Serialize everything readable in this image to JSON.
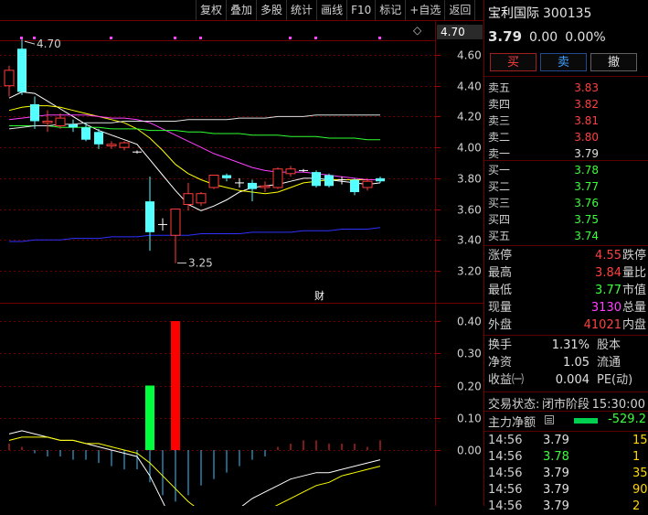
{
  "toolbar": {
    "items": [
      "复权",
      "叠加",
      "多股",
      "统计",
      "画线",
      "F10",
      "标记",
      "+自选",
      "返回"
    ]
  },
  "main_chart": {
    "price_ticks": [
      "4.60",
      "4.40",
      "4.20",
      "4.00",
      "3.80",
      "3.60",
      "3.40",
      "3.20"
    ],
    "current_price_label": "4.70",
    "high_annotation": "4.70",
    "low_annotation": "3.25",
    "marker_glyph": "◇",
    "event_flag": "财",
    "indicator_ticks": [
      "0.40",
      "0.30",
      "0.20",
      "0.10",
      "0.00"
    ],
    "colors": {
      "up": "#ff3c3c",
      "down": "#54ffff",
      "ma5": "#ffffff",
      "ma10": "#ffff00",
      "ma20": "#ff40ff",
      "ma60": "#30ff30",
      "ma120": "#e0e0e0",
      "ma250": "#3030ff",
      "grid": "#6e0000"
    }
  },
  "chart_data": [
    {
      "type": "candlestick",
      "title": "",
      "ylim": [
        3.1,
        4.75
      ],
      "candles": [
        {
          "o": 4.4,
          "h": 4.53,
          "l": 4.33,
          "c": 4.5,
          "dir": "up"
        },
        {
          "o": 4.64,
          "h": 4.7,
          "l": 4.34,
          "c": 4.36,
          "dir": "down"
        },
        {
          "o": 4.28,
          "h": 4.33,
          "l": 4.12,
          "c": 4.17,
          "dir": "down"
        },
        {
          "o": 4.16,
          "h": 4.24,
          "l": 4.1,
          "c": 4.17,
          "dir": "up"
        },
        {
          "o": 4.14,
          "h": 4.22,
          "l": 4.12,
          "c": 4.19,
          "dir": "up"
        },
        {
          "o": 4.15,
          "h": 4.18,
          "l": 4.1,
          "c": 4.13,
          "dir": "down"
        },
        {
          "o": 4.13,
          "h": 4.16,
          "l": 4.04,
          "c": 4.05,
          "dir": "down"
        },
        {
          "o": 4.1,
          "h": 4.12,
          "l": 3.99,
          "c": 4.02,
          "dir": "down"
        },
        {
          "o": 4.01,
          "h": 4.04,
          "l": 3.99,
          "c": 4.02,
          "dir": "up"
        },
        {
          "o": 4.0,
          "h": 4.04,
          "l": 3.98,
          "c": 4.03,
          "dir": "up"
        },
        {
          "o": 3.97,
          "h": 3.98,
          "l": 3.96,
          "c": 3.97,
          "dir": "flat"
        },
        {
          "o": 3.65,
          "h": 3.81,
          "l": 3.33,
          "c": 3.45,
          "dir": "down"
        },
        {
          "o": 3.5,
          "h": 3.54,
          "l": 3.46,
          "c": 3.5,
          "dir": "flat"
        },
        {
          "o": 3.43,
          "h": 3.6,
          "l": 3.25,
          "c": 3.6,
          "dir": "up"
        },
        {
          "o": 3.63,
          "h": 3.77,
          "l": 3.59,
          "c": 3.7,
          "dir": "up"
        },
        {
          "o": 3.64,
          "h": 3.71,
          "l": 3.62,
          "c": 3.7,
          "dir": "up"
        },
        {
          "o": 3.74,
          "h": 3.82,
          "l": 3.73,
          "c": 3.82,
          "dir": "up"
        },
        {
          "o": 3.82,
          "h": 3.83,
          "l": 3.78,
          "c": 3.8,
          "dir": "down"
        },
        {
          "o": 3.77,
          "h": 3.8,
          "l": 3.74,
          "c": 3.77,
          "dir": "flat"
        },
        {
          "o": 3.77,
          "h": 3.79,
          "l": 3.65,
          "c": 3.73,
          "dir": "down"
        },
        {
          "o": 3.74,
          "h": 3.78,
          "l": 3.71,
          "c": 3.75,
          "dir": "up"
        },
        {
          "o": 3.74,
          "h": 3.87,
          "l": 3.73,
          "c": 3.86,
          "dir": "up"
        },
        {
          "o": 3.83,
          "h": 3.88,
          "l": 3.81,
          "c": 3.86,
          "dir": "up"
        },
        {
          "o": 3.84,
          "h": 3.86,
          "l": 3.84,
          "c": 3.85,
          "dir": "flat"
        },
        {
          "o": 3.84,
          "h": 3.85,
          "l": 3.74,
          "c": 3.75,
          "dir": "down"
        },
        {
          "o": 3.82,
          "h": 3.83,
          "l": 3.74,
          "c": 3.75,
          "dir": "down"
        },
        {
          "o": 3.79,
          "h": 3.81,
          "l": 3.76,
          "c": 3.78,
          "dir": "flat"
        },
        {
          "o": 3.79,
          "h": 3.8,
          "l": 3.69,
          "c": 3.71,
          "dir": "down"
        },
        {
          "o": 3.74,
          "h": 3.8,
          "l": 3.72,
          "c": 3.78,
          "dir": "up"
        },
        {
          "o": 3.78,
          "h": 3.81,
          "l": 3.77,
          "c": 3.8,
          "dir": "down"
        }
      ],
      "ma_lines": [
        {
          "key": "ma5",
          "values": [
            4.32,
            4.36,
            4.35,
            4.3,
            4.25,
            4.2,
            4.15,
            4.11,
            4.08,
            4.05,
            4.02,
            3.92,
            3.82,
            3.72,
            3.63,
            3.59,
            3.62,
            3.66,
            3.71,
            3.74,
            3.75,
            3.76,
            3.78,
            3.8,
            3.8,
            3.79,
            3.78,
            3.77,
            3.76,
            3.77
          ]
        },
        {
          "key": "ma10",
          "values": [
            4.24,
            4.26,
            4.27,
            4.27,
            4.26,
            4.24,
            4.22,
            4.2,
            4.18,
            4.16,
            4.12,
            4.06,
            3.98,
            3.89,
            3.83,
            3.79,
            3.76,
            3.74,
            3.72,
            3.71,
            3.7,
            3.71,
            3.74,
            3.77,
            3.78,
            3.79,
            3.79,
            3.79,
            3.79,
            3.79
          ]
        },
        {
          "key": "ma20",
          "values": [
            4.18,
            4.19,
            4.2,
            4.21,
            4.21,
            4.21,
            4.21,
            4.2,
            4.19,
            4.19,
            4.18,
            4.16,
            4.12,
            4.08,
            4.04,
            4.0,
            3.96,
            3.93,
            3.9,
            3.87,
            3.85,
            3.84,
            3.84,
            3.84,
            3.83,
            3.82,
            3.81,
            3.8,
            3.79,
            3.79
          ]
        },
        {
          "key": "ma60",
          "values": [
            4.14,
            4.14,
            4.14,
            4.14,
            4.13,
            4.13,
            4.13,
            4.13,
            4.12,
            4.12,
            4.12,
            4.11,
            4.11,
            4.11,
            4.1,
            4.1,
            4.09,
            4.09,
            4.09,
            4.08,
            4.08,
            4.08,
            4.07,
            4.07,
            4.07,
            4.06,
            4.06,
            4.06,
            4.05,
            4.05
          ]
        },
        {
          "key": "ma120",
          "values": [
            4.12,
            4.13,
            4.14,
            4.14,
            4.15,
            4.15,
            4.16,
            4.16,
            4.16,
            4.17,
            4.17,
            4.17,
            4.17,
            4.17,
            4.18,
            4.18,
            4.18,
            4.18,
            4.19,
            4.19,
            4.19,
            4.2,
            4.2,
            4.2,
            4.21,
            4.21,
            4.21,
            4.21,
            4.21,
            4.21
          ]
        },
        {
          "key": "ma250",
          "values": [
            3.39,
            3.39,
            3.4,
            3.4,
            3.4,
            3.41,
            3.41,
            3.41,
            3.42,
            3.42,
            3.42,
            3.43,
            3.43,
            3.43,
            3.43,
            3.44,
            3.44,
            3.44,
            3.44,
            3.45,
            3.45,
            3.45,
            3.45,
            3.46,
            3.46,
            3.46,
            3.47,
            3.47,
            3.47,
            3.48
          ]
        }
      ]
    },
    {
      "type": "bar",
      "title": "",
      "ylim": [
        -0.35,
        0.45
      ],
      "big_bars": [
        {
          "index": 11,
          "value": 0.2,
          "color": "#00ff3c"
        },
        {
          "index": 13,
          "value": 0.4,
          "color": "#ff0000"
        }
      ],
      "ticks_values": [
        0.02,
        0.01,
        -0.01,
        -0.02,
        -0.02,
        -0.03,
        -0.03,
        -0.04,
        -0.05,
        -0.06,
        -0.06,
        -0.1,
        -0.14,
        -0.16,
        -0.14,
        -0.11,
        -0.09,
        -0.07,
        -0.05,
        -0.03,
        -0.02,
        0.01,
        0.02,
        0.03,
        0.03,
        0.02,
        0.02,
        0.02,
        0.01,
        0.03
      ],
      "line_white": [
        0.05,
        0.06,
        0.05,
        0.04,
        0.03,
        0.03,
        0.02,
        0.01,
        0.0,
        -0.01,
        -0.02,
        -0.08,
        -0.16,
        -0.24,
        -0.27,
        -0.26,
        -0.24,
        -0.21,
        -0.18,
        -0.15,
        -0.13,
        -0.11,
        -0.09,
        -0.08,
        -0.07,
        -0.07,
        -0.06,
        -0.05,
        -0.04,
        -0.03
      ],
      "line_yellow": [
        0.03,
        0.04,
        0.04,
        0.04,
        0.03,
        0.03,
        0.02,
        0.02,
        0.01,
        0.0,
        -0.01,
        -0.04,
        -0.08,
        -0.12,
        -0.16,
        -0.19,
        -0.21,
        -0.21,
        -0.21,
        -0.2,
        -0.19,
        -0.17,
        -0.15,
        -0.13,
        -0.11,
        -0.1,
        -0.08,
        -0.07,
        -0.06,
        -0.05
      ]
    }
  ],
  "stock": {
    "name": "宝利国际",
    "code": "300135",
    "price": "3.79",
    "change": "0.00",
    "change_pct": "0.00%"
  },
  "trade_buttons": {
    "buy": "买",
    "sell": "卖",
    "cancel": "撤"
  },
  "order_book": {
    "asks": [
      {
        "label": "卖五",
        "price": "3.83",
        "color": "red"
      },
      {
        "label": "卖四",
        "price": "3.82",
        "color": "red"
      },
      {
        "label": "卖三",
        "price": "3.81",
        "color": "red"
      },
      {
        "label": "卖二",
        "price": "3.80",
        "color": "red"
      },
      {
        "label": "卖一",
        "price": "3.79",
        "color": "white"
      }
    ],
    "bids": [
      {
        "label": "买一",
        "price": "3.78",
        "color": "green"
      },
      {
        "label": "买二",
        "price": "3.77",
        "color": "green"
      },
      {
        "label": "买三",
        "price": "3.76",
        "color": "green"
      },
      {
        "label": "买四",
        "price": "3.75",
        "color": "green"
      },
      {
        "label": "买五",
        "price": "3.74",
        "color": "green"
      }
    ]
  },
  "stats1": [
    {
      "l1": "涨停",
      "v1": "4.55",
      "c1": "red",
      "l2": "跌停"
    },
    {
      "l1": "最高",
      "v1": "3.84",
      "c1": "red",
      "l2": "量比"
    },
    {
      "l1": "最低",
      "v1": "3.77",
      "c1": "green",
      "l2": "市值"
    },
    {
      "l1": "现量",
      "v1": "3130",
      "c1": "magenta",
      "l2": "总量"
    },
    {
      "l1": "外盘",
      "v1": "41021",
      "c1": "red",
      "l2": "内盘"
    }
  ],
  "stats2": [
    {
      "l1": "换手",
      "v1": "1.31%",
      "l2": "股本"
    },
    {
      "l1": "净资",
      "v1": "1.05",
      "l2": "流通"
    },
    {
      "l1": "收益㈠",
      "v1": "0.004",
      "l2": "PE(动)"
    }
  ],
  "trade_status": {
    "label": "交易状态:",
    "value": "闭市阶段",
    "time": "15:30:00"
  },
  "net_flow": {
    "label": "主力净额",
    "value": "-529.2"
  },
  "ticks": [
    {
      "time": "14:56",
      "price": "3.79",
      "price_color": "white",
      "vol": "15"
    },
    {
      "time": "14:56",
      "price": "3.78",
      "price_color": "green",
      "vol": "1"
    },
    {
      "time": "14:56",
      "price": "3.79",
      "price_color": "white",
      "vol": "35"
    },
    {
      "time": "14:56",
      "price": "3.79",
      "price_color": "white",
      "vol": "90"
    },
    {
      "time": "14:56",
      "price": "3.79",
      "price_color": "white",
      "vol": "2"
    }
  ]
}
